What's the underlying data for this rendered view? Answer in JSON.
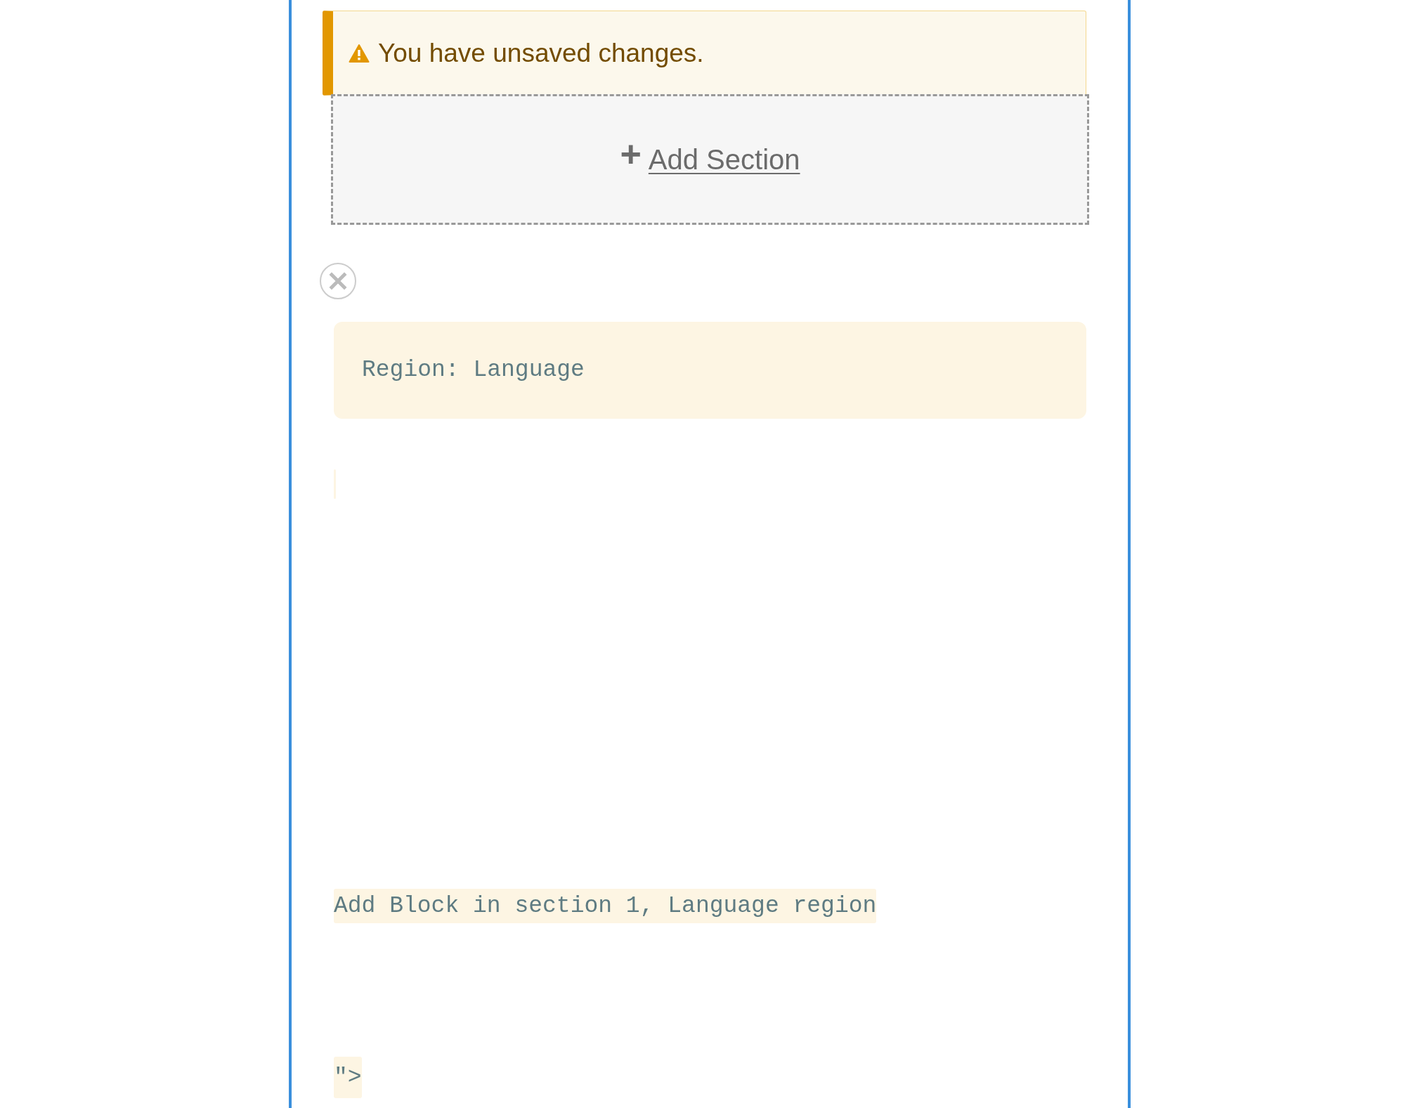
{
  "warning": {
    "text": "You have unsaved changes."
  },
  "add_section": {
    "icon": "+",
    "label": "Add Section"
  },
  "region": {
    "label": "Region: Language"
  },
  "add_block": {
    "label": "Add Block in section 1, Language region"
  },
  "trailing_text": "\">"
}
